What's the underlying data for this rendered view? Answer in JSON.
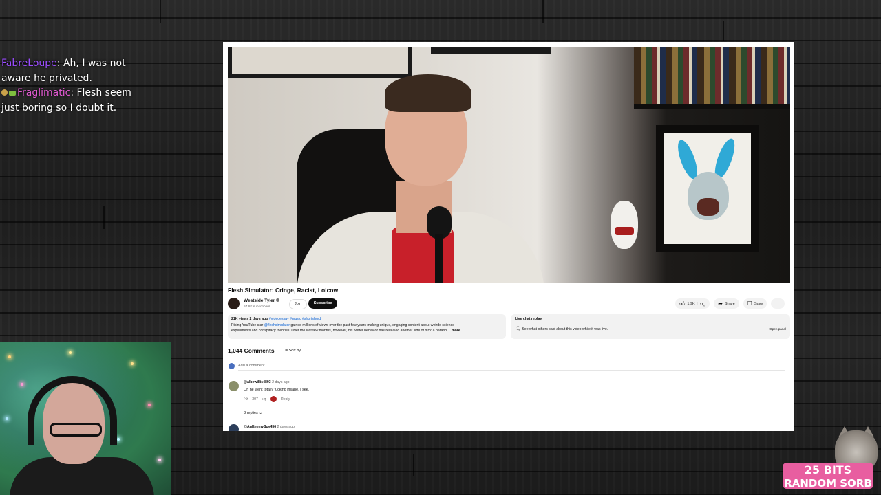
{
  "chat": {
    "messages": [
      {
        "user": "FabreLoupe",
        "user_color": "#9b4dff",
        "text": ": Ah, I was not aware he privated."
      },
      {
        "user": "Fraglimatic",
        "user_color": "#e15ad1",
        "text": ": Flesh seem just boring so I doubt it."
      }
    ]
  },
  "video": {
    "title": "Flesh Simulator: Cringe, Racist, Lolcow",
    "channel": "Westside Tyler",
    "subscribers": "57.6K subscribers",
    "join_label": "Join",
    "subscribe_label": "Subscribe",
    "likes": "1.9K",
    "share_label": "Share",
    "save_label": "Save"
  },
  "description": {
    "views": "21K views",
    "age": "2 days ago",
    "tags": "#videoessay #music #shortsfeed",
    "line1_pre": "Rising YouTube star ",
    "mention": "@fleshsimulator",
    "line1_post": " gained millions of views over the past few years making unique, engaging content about weirdo science",
    "line2": "experiments and conspiracy theories. Over the last few months, however, his twitter behavior has revealed another side of him: a paranoi",
    "more": "...more"
  },
  "live_chat": {
    "title": "Live chat replay",
    "body": "See what others said about this video while it was live.",
    "open_label": "Open panel"
  },
  "comments": {
    "count": "1,044 Comments",
    "sort_label": "Sort by",
    "add_placeholder": "Add a comment...",
    "items": [
      {
        "user": "@albewillis4893",
        "time": "2 days ago",
        "text": "Oh he went totally fucking insane, I see.",
        "likes": "307",
        "reply_label": "Reply",
        "replies_label": "3 replies"
      },
      {
        "user": "@AnEnemySpy456",
        "time": "2 days ago"
      }
    ]
  },
  "promo": {
    "line1": "25 BITS",
    "line2": "RANDOM SORB"
  }
}
